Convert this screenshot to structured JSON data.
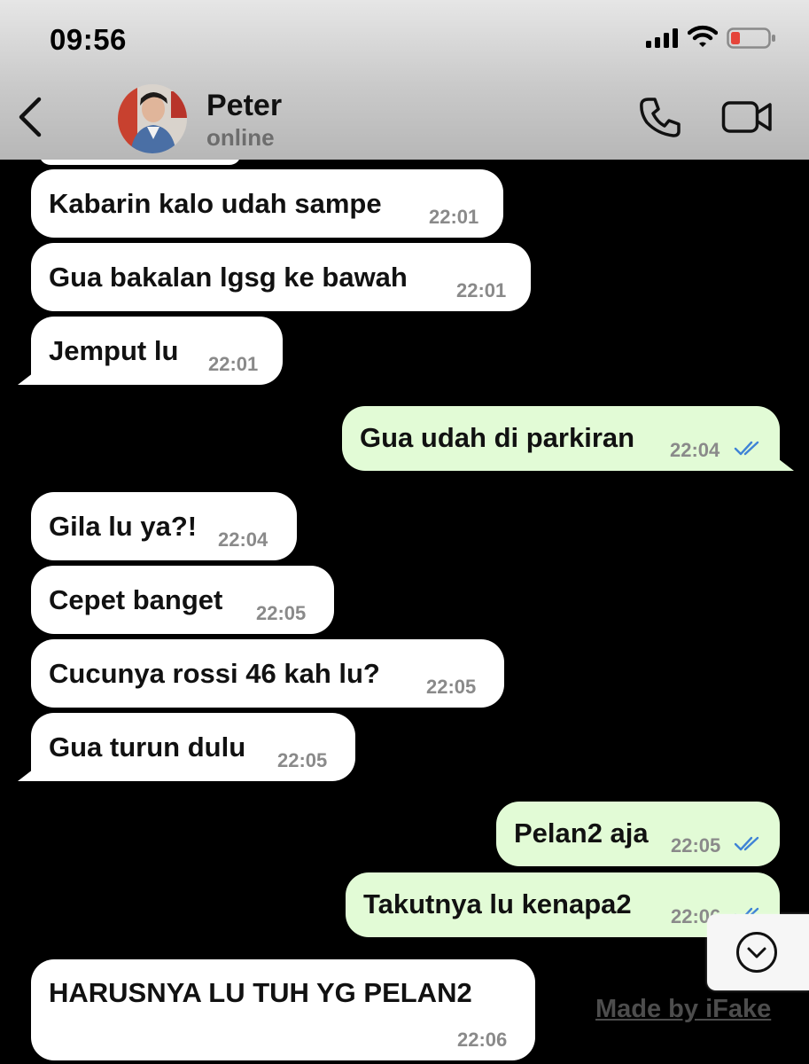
{
  "status_bar": {
    "time": "09:56",
    "signal_icon": "cellular-signal-icon",
    "wifi_icon": "wifi-icon",
    "battery_icon": "battery-low-icon",
    "battery_color": "#e5453b"
  },
  "header": {
    "back_icon": "chevron-left-icon",
    "contact_name": "Peter",
    "contact_status": "online",
    "call_icon": "phone-icon",
    "video_icon": "video-camera-icon"
  },
  "messages": [
    {
      "direction": "in",
      "text": "Kabarin kalo udah sampe",
      "time": "22:01"
    },
    {
      "direction": "in",
      "text": "Gua bakalan lgsg ke bawah",
      "time": "22:01"
    },
    {
      "direction": "in",
      "text": "Jemput lu",
      "time": "22:01"
    },
    {
      "direction": "out",
      "text": "Gua udah di parkiran",
      "time": "22:04",
      "read": true
    },
    {
      "direction": "in",
      "text": "Gila lu ya?!",
      "time": "22:04"
    },
    {
      "direction": "in",
      "text": "Cepet banget",
      "time": "22:05"
    },
    {
      "direction": "in",
      "text": "Cucunya rossi 46 kah lu?",
      "time": "22:05"
    },
    {
      "direction": "in",
      "text": "Gua turun dulu",
      "time": "22:05"
    },
    {
      "direction": "out",
      "text": "Pelan2 aja",
      "time": "22:05",
      "read": true
    },
    {
      "direction": "out",
      "text": "Takutnya lu kenapa2",
      "time": "22:06",
      "read": true
    },
    {
      "direction": "in",
      "text": "HARUSNYA LU TUH YG PELAN2",
      "time": "22:06"
    }
  ],
  "scroll_down_icon": "chevron-down-circle-icon",
  "watermark": "Made by iFake",
  "colors": {
    "incoming_bubble": "#ffffff",
    "outgoing_bubble": "#e2fbd6",
    "read_ticks": "#3f83d6",
    "chat_background": "#000000"
  }
}
